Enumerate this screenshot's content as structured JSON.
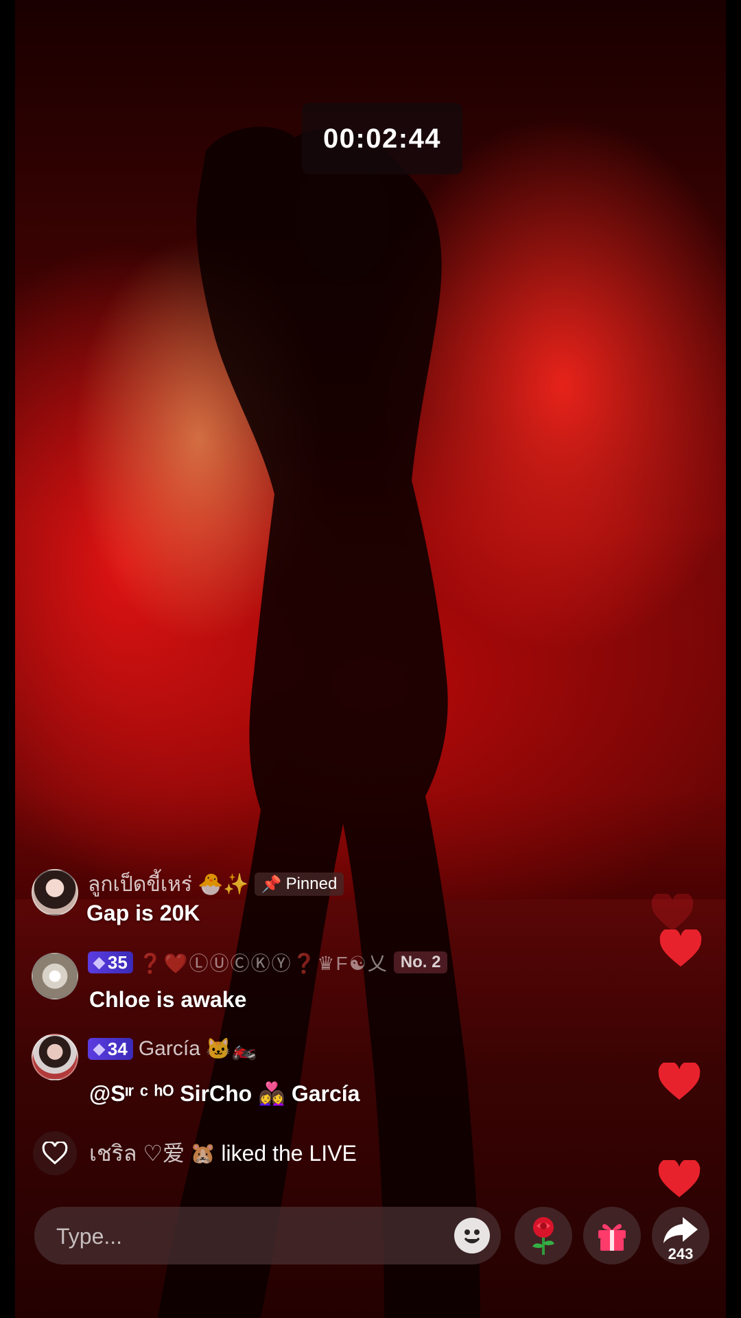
{
  "live": {
    "timer": "00:02:44"
  },
  "comments": [
    {
      "username": "ลูกเป็ดขี้เหร่",
      "username_emoji": "🐣✨",
      "pinned_label": "Pinned",
      "text": "Gap is 20K"
    },
    {
      "level": "35",
      "username": "LUCKY",
      "username_deco": "❓❤️ⓁⓊⒸⓀⓎ❓♛F☯乂",
      "rank_badge": "No. 2",
      "text": "Chloe is awake"
    },
    {
      "level": "34",
      "username": "García",
      "username_emoji": "🐱🏍️",
      "text": "@Sᶦʳ ᶜ ʰᴼ SirCho 👩‍❤️‍👩 García"
    }
  ],
  "like_event": {
    "username": "เชริล ♡爱",
    "emoji": "🐹",
    "text": "liked the LIVE"
  },
  "composer": {
    "placeholder": "Type..."
  },
  "actions": {
    "share_count": "243"
  },
  "icons": [
    "pin-icon",
    "gem-icon",
    "heart-outline-icon",
    "emoji-face-icon",
    "rose-gift-icon",
    "gift-box-icon",
    "share-arrow-icon",
    "floating-heart-icon"
  ],
  "colors": {
    "accent_red": "#e8222c",
    "level_badge": "#5b3de0",
    "bar_bg": "#46302f"
  }
}
